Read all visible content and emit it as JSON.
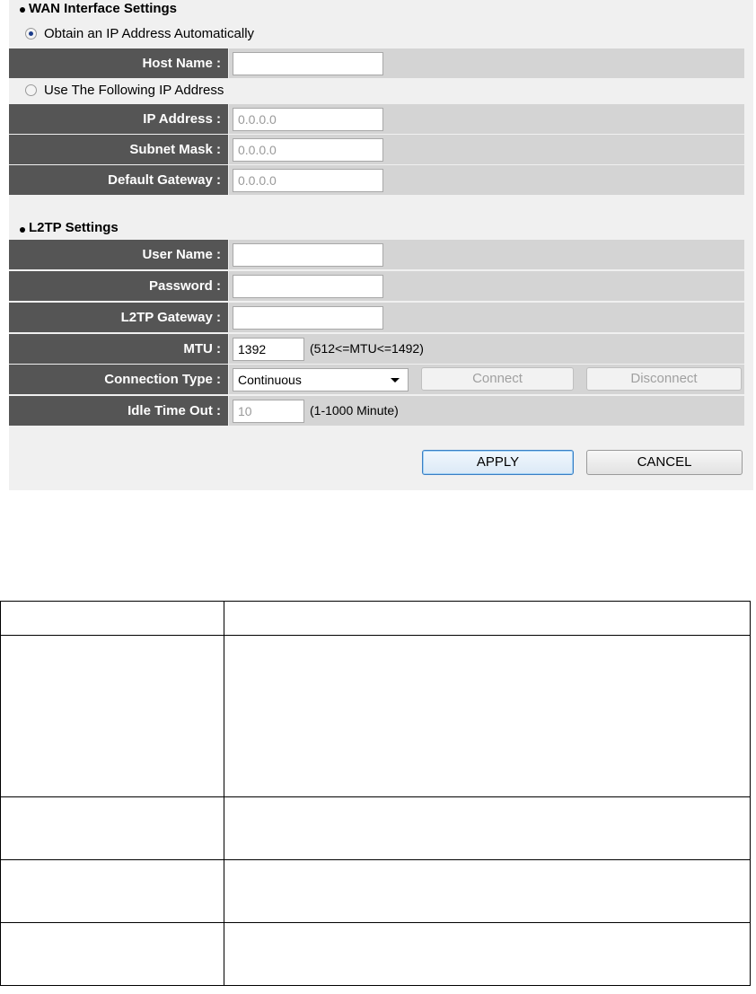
{
  "wan": {
    "title": "WAN Interface Settings",
    "auto_label": "Obtain an IP Address Automatically",
    "host_name_label": "Host Name :",
    "host_name_value": "",
    "manual_label": "Use The Following IP Address",
    "ip_label": "IP Address :",
    "ip_value": "0.0.0.0",
    "subnet_label": "Subnet Mask :",
    "subnet_value": "0.0.0.0",
    "gateway_label": "Default Gateway :",
    "gateway_value": "0.0.0.0",
    "selected_mode": "auto"
  },
  "l2tp": {
    "title": "L2TP Settings",
    "user_label": "User Name :",
    "user_value": "",
    "password_label": "Password :",
    "password_value": "",
    "l2tp_gateway_label": "L2TP Gateway :",
    "l2tp_gateway_value": "",
    "mtu_label": "MTU :",
    "mtu_value": "1392",
    "mtu_hint": "(512<=MTU<=1492)",
    "conn_type_label": "Connection Type :",
    "conn_type_value": "Continuous",
    "connect_label": "Connect",
    "disconnect_label": "Disconnect",
    "idle_label": "Idle Time Out :",
    "idle_value": "10",
    "idle_hint": "(1-1000 Minute)"
  },
  "actions": {
    "apply": "APPLY",
    "cancel": "CANCEL"
  },
  "doc_table": {
    "rows": [
      [
        "",
        ""
      ],
      [
        "",
        ""
      ],
      [
        "",
        ""
      ],
      [
        "",
        ""
      ],
      [
        "",
        ""
      ]
    ]
  },
  "colors": {
    "label_bg": "#555555",
    "value_bg": "#d4d4d4",
    "panel_bg": "#f0f0f0",
    "apply_border": "#3a7fc4"
  }
}
